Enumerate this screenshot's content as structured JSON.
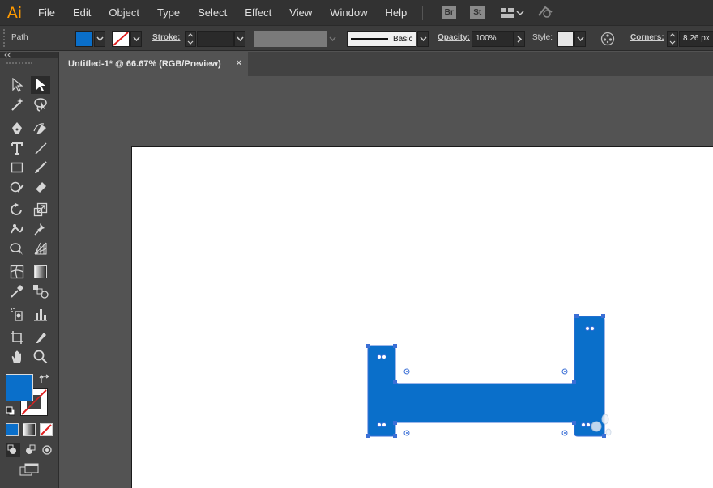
{
  "app": {
    "logo_text": "Ai",
    "menus": [
      "File",
      "Edit",
      "Object",
      "Type",
      "Select",
      "Effect",
      "View",
      "Window",
      "Help"
    ],
    "bridge_badge": "Br",
    "stock_badge": "St"
  },
  "control_bar": {
    "selection_type": "Path",
    "fill_color": "#0a6fca",
    "stroke_label": "Stroke:",
    "stroke_style": "Basic",
    "opacity_label": "Opacity:",
    "opacity_value": "100%",
    "style_label": "Style:",
    "corners_label": "Corners:",
    "corners_value": "8.26 px"
  },
  "document": {
    "tab_title": "Untitled-1* @ 66.67% (RGB/Preview)",
    "close_glyph": "×"
  },
  "tools": {
    "fill_color": "#0a6fca",
    "stroke_color": "none"
  },
  "artwork": {
    "shape_color": "#0a6fca",
    "handle_color": "#3b6fd6",
    "description_hidden": ""
  },
  "colors": {
    "accent": "#0a6fca",
    "menubar_bg": "#323232",
    "panel_bg": "#424242",
    "canvas_bg": "#535353"
  }
}
